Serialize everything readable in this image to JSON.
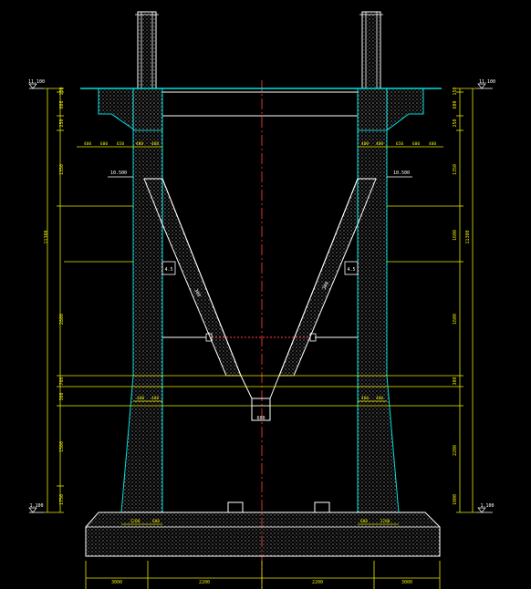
{
  "drawing": {
    "type": "CAD elevation drawing — bridge pier / bent (dark model-space view)",
    "background": "#000000",
    "colors": {
      "dimension": "#e8e800",
      "outline": "#00e0e0",
      "structure": "#ffffff",
      "centerline": "#e03030",
      "hatch_dots": "#c8c8c8"
    },
    "elevation_marks": {
      "top_left": "11.100",
      "top_right": "11.100",
      "bottom_left": "1.100",
      "bottom_right": "1.100"
    },
    "bracket_marks": {
      "left": "10.500",
      "right": "10.500"
    },
    "overall_dims": {
      "left": "11300",
      "right": "11300"
    },
    "left_chain": [
      "150",
      "600",
      "250",
      "1350",
      "2800",
      "700",
      "300",
      "1500",
      "1750"
    ],
    "right_chain": [
      "150",
      "600",
      "250",
      "1350",
      "1600",
      "1600",
      "300",
      "2200",
      "1000"
    ],
    "cap_dims_left": [
      "400",
      "600",
      "650",
      "400",
      "400"
    ],
    "cap_dims_right": [
      "400",
      "400",
      "650",
      "600",
      "400"
    ],
    "column_base_dims": [
      "400",
      "400"
    ],
    "column_foot_dims_left": [
      "1200",
      "600"
    ],
    "column_foot_dims_right": [
      "600",
      "1200"
    ],
    "strut_labels": [
      "300",
      "300"
    ],
    "gusset_labels": [
      "4.5",
      "4.5"
    ],
    "tie_beam_dim": "600",
    "footing_dims": [
      "3000",
      "2200",
      "2200",
      "3000"
    ]
  }
}
